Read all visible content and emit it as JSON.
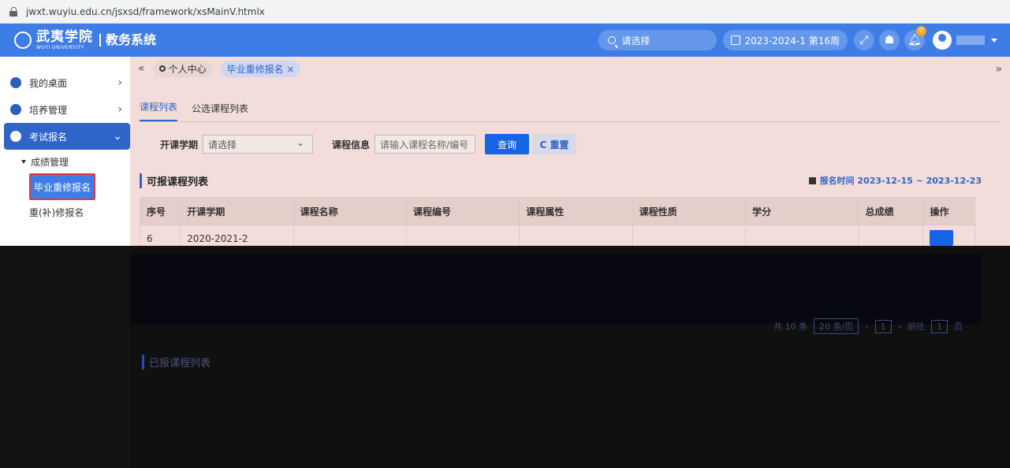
{
  "browser": {
    "url": "jwxt.wuyiu.edu.cn/jsxsd/framework/xsMainV.htmlx"
  },
  "header": {
    "logo_main": "武夷学院",
    "logo_sub": "WUYI UNIVERSITY",
    "system_title": "教务系统",
    "search_placeholder": "请选择",
    "term": "2023-2024-1 第16周",
    "notification_count": "0"
  },
  "sidebar": {
    "items": [
      {
        "label": "我的桌面"
      },
      {
        "label": "培养管理"
      },
      {
        "label": "考试报名"
      }
    ],
    "tree_parent": "成绩管理",
    "tree_children": [
      {
        "label": "毕业重修报名"
      },
      {
        "label": "重(补)修报名"
      }
    ]
  },
  "tabs": {
    "personal_center": "个人中心",
    "current": "毕业重修报名 ×"
  },
  "subtabs": [
    "课程列表",
    "公选课程列表"
  ],
  "filter": {
    "term_label": "开课学期",
    "term_value": "请选择",
    "course_label": "课程信息",
    "course_placeholder": "请输入课程名称/编号",
    "query_button": "查询",
    "reset_button": "C 重置"
  },
  "available_panel": {
    "title": "可报课程列表",
    "time_label": "报名时间 2023-12-15 ~ 2023-12-23",
    "columns": [
      "序号",
      "开课学期",
      "课程名称",
      "课程编号",
      "课程属性",
      "课程性质",
      "学分",
      "总成绩",
      "操作"
    ],
    "rows": [
      {
        "no": "6",
        "term": "2020-2021-2"
      }
    ]
  },
  "pager": {
    "total": "共 10 条",
    "page_size": "20 条/页",
    "page": "1",
    "goto_label": "前往",
    "goto_page": "1",
    "page_suffix": "页"
  },
  "registered_panel": {
    "title": "已报课程列表"
  }
}
